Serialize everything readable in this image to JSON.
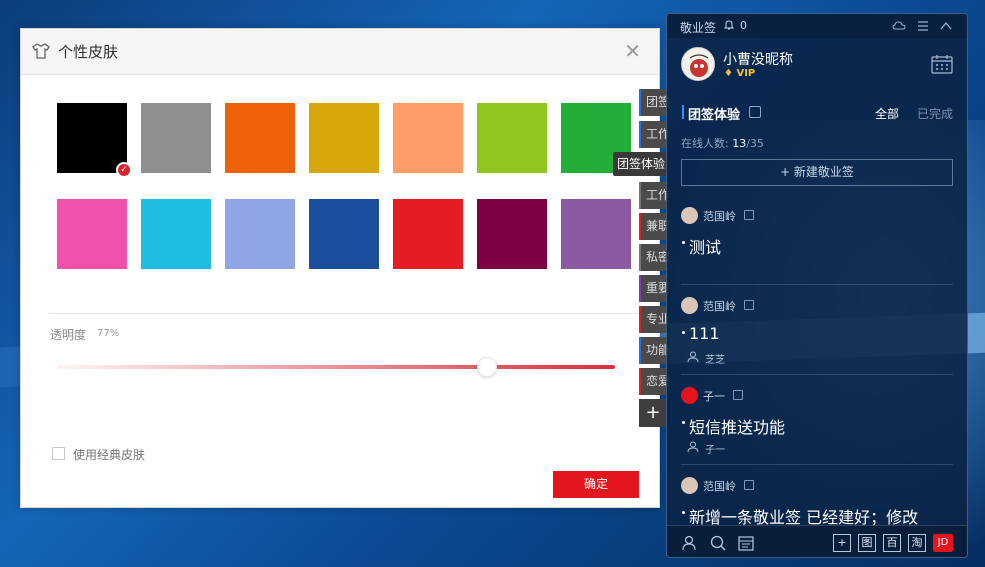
{
  "dialog": {
    "title": "个性皮肤",
    "close_glyph": "✕",
    "swatches": [
      {
        "color": "#000000",
        "selected": true
      },
      {
        "color": "#8f8f8f",
        "selected": false
      },
      {
        "color": "#ec6109",
        "selected": false
      },
      {
        "color": "#d8a80b",
        "selected": false
      },
      {
        "color": "#fd9d67",
        "selected": false
      },
      {
        "color": "#91c621",
        "selected": false
      },
      {
        "color": "#22ae38",
        "selected": false
      },
      {
        "color": "#f151ac",
        "selected": false
      },
      {
        "color": "#1fbde2",
        "selected": false
      },
      {
        "color": "#90a5e5",
        "selected": false
      },
      {
        "color": "#1a4f9c",
        "selected": false
      },
      {
        "color": "#e31c25",
        "selected": false
      },
      {
        "color": "#7d0042",
        "selected": false
      },
      {
        "color": "#8c5aa2",
        "selected": false
      }
    ],
    "opacity_label": "透明度",
    "opacity_value": "77%",
    "opacity_level": 0.77,
    "classic_skin_label": "使用经典皮肤",
    "classic_skin_checked": false,
    "confirm_label": "确定"
  },
  "side_tabs": [
    {
      "label": "团签体验",
      "accent": "blue"
    },
    {
      "label": "工作",
      "accent": "blue"
    },
    {
      "label": "工作",
      "accent": "grey"
    },
    {
      "label": "兼职",
      "accent": "red"
    },
    {
      "label": "私密",
      "accent": "grey"
    },
    {
      "label": "重要",
      "accent": "purple"
    },
    {
      "label": "专业",
      "accent": "red"
    },
    {
      "label": "功能",
      "accent": "blue"
    },
    {
      "label": "恋爱",
      "accent": "red"
    }
  ],
  "side_tooltip": "团签体验",
  "side_plus": "+",
  "panel": {
    "app_title": "敬业签",
    "notification_count": "0",
    "username": "小曹没昵称",
    "vip_label": "VIP",
    "group_name": "团签体验",
    "filter_all": "全部",
    "filter_done": "已完成",
    "online_label": "在线人数:",
    "online_count": "13",
    "online_total": "/35",
    "new_note_label": "+ 新建敬业签",
    "notes": [
      {
        "author": "范国岭",
        "text": "测试",
        "assignee": ""
      },
      {
        "author": "范国岭",
        "text": "111",
        "assignee": "芝芝"
      },
      {
        "author": "子一",
        "text": "短信推送功能",
        "assignee": "子一"
      },
      {
        "author": "范国岭",
        "text": "新增一条敬业签 已经建好；修改",
        "assignee": ""
      }
    ],
    "bottom_tools": [
      "图",
      "百",
      "淘",
      "JD"
    ]
  }
}
